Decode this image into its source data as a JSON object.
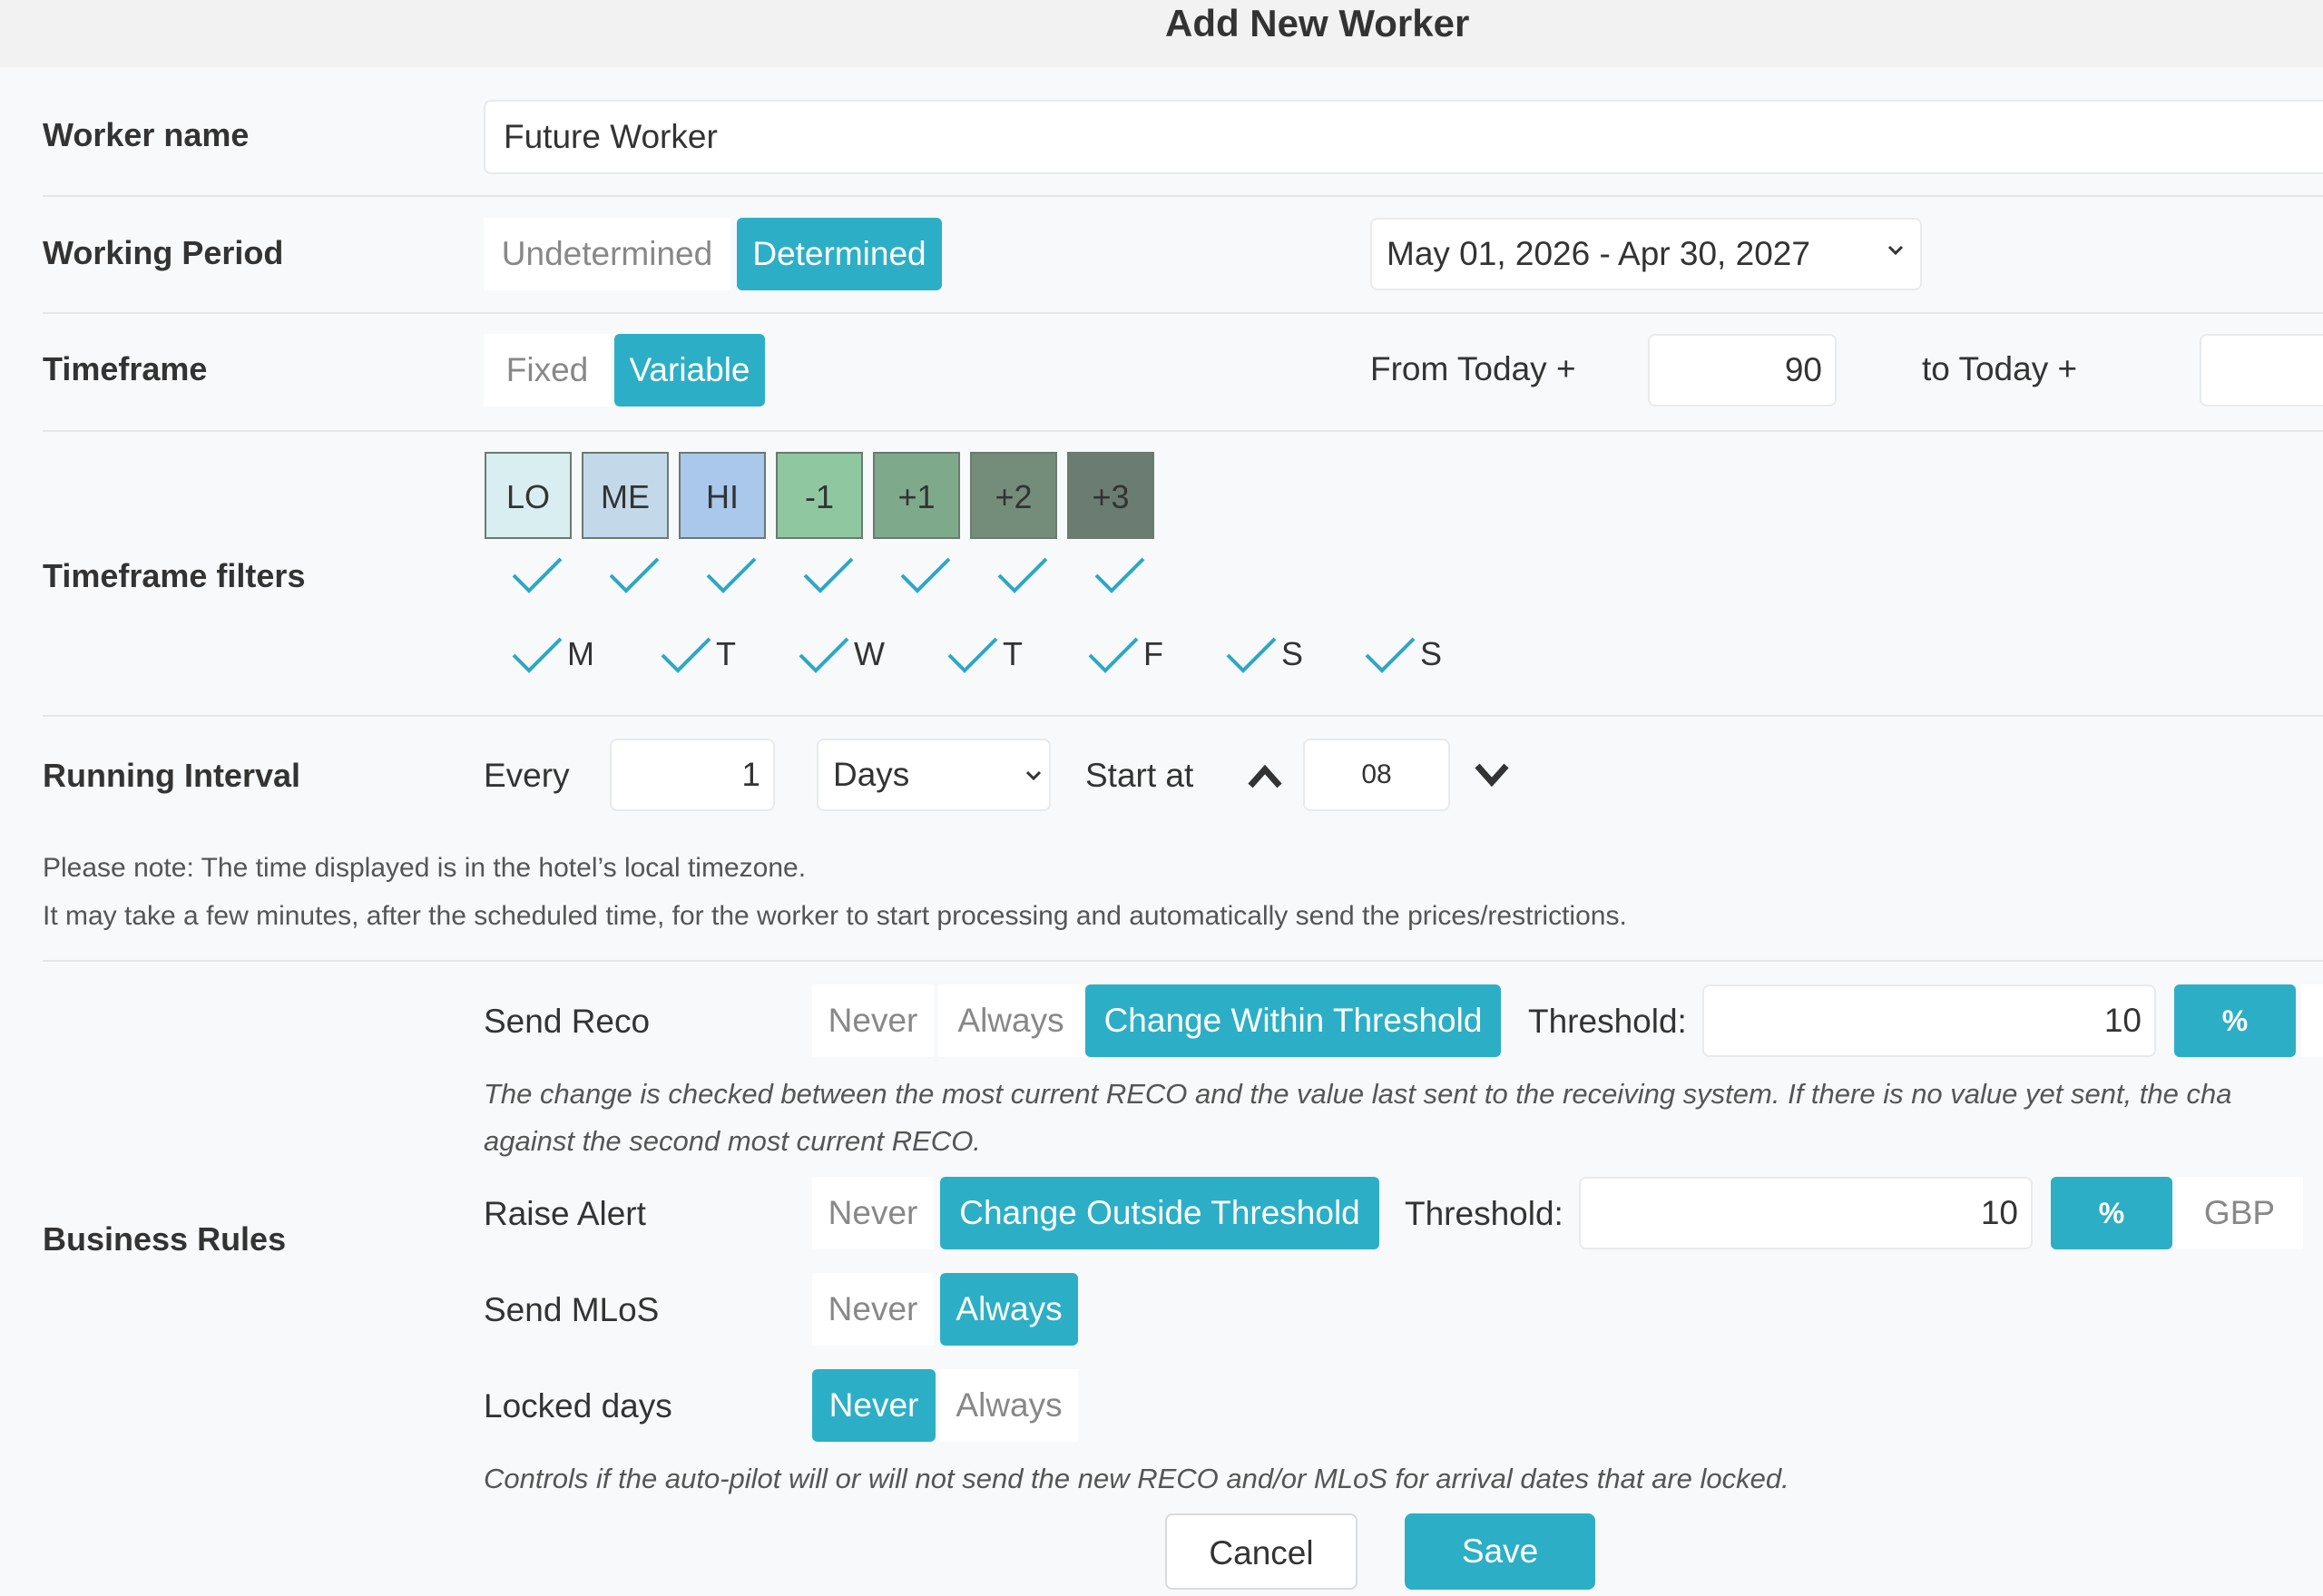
{
  "dialog": {
    "title": "Add New Worker"
  },
  "worker_name": {
    "label": "Worker name",
    "value": "Future Worker"
  },
  "working_period": {
    "label": "Working Period",
    "options": [
      "Undetermined",
      "Determined"
    ],
    "selected": "Determined",
    "date_range": "May 01, 2026 - Apr 30, 2027"
  },
  "timeframe": {
    "label": "Timeframe",
    "options": [
      "Fixed",
      "Variable"
    ],
    "selected": "Variable",
    "from_label": "From Today +",
    "from_value": "90",
    "to_label": "to Today +"
  },
  "timeframe_filters": {
    "label": "Timeframe filters",
    "chips": [
      {
        "label": "LO",
        "color": "#d8eef0",
        "checked": true
      },
      {
        "label": "ME",
        "color": "#c3d9ea",
        "checked": true
      },
      {
        "label": "HI",
        "color": "#a9c8ec",
        "checked": true
      },
      {
        "label": "-1",
        "color": "#8fc8a0",
        "checked": true
      },
      {
        "label": "+1",
        "color": "#7fa98b",
        "checked": true
      },
      {
        "label": "+2",
        "color": "#748d7a",
        "checked": true
      },
      {
        "label": "+3",
        "color": "#6b7d72",
        "checked": true
      }
    ],
    "days": [
      "M",
      "T",
      "W",
      "T",
      "F",
      "S",
      "S"
    ]
  },
  "running_interval": {
    "label": "Running Interval",
    "every_label": "Every",
    "every_value": "1",
    "unit": "Days",
    "start_label": "Start at",
    "start_value": "08"
  },
  "notes": {
    "line1": "Please note: The time displayed is in the hotel’s local timezone.",
    "line2": "It may take a few minutes, after the scheduled time, for the worker to start processing and automatically send the prices/restrictions."
  },
  "business_rules": {
    "label": "Business Rules",
    "send_reco": {
      "label": "Send Reco",
      "options": [
        "Never",
        "Always",
        "Change Within Threshold"
      ],
      "selected": "Change Within Threshold",
      "threshold_label": "Threshold:",
      "threshold_value": "10",
      "unit_selected": "%",
      "help_line1": "The change is checked between the most current RECO and the value last sent to the receiving system. If there is no value yet sent, the cha",
      "help_line2": "against the second most current RECO."
    },
    "raise_alert": {
      "label": "Raise Alert",
      "options": [
        "Never",
        "Change Outside Threshold"
      ],
      "selected": "Change Outside Threshold",
      "threshold_label": "Threshold:",
      "threshold_value": "10",
      "units": [
        "%",
        "GBP"
      ],
      "unit_selected": "%"
    },
    "send_mlos": {
      "label": "Send MLoS",
      "options": [
        "Never",
        "Always"
      ],
      "selected": "Always"
    },
    "locked_days": {
      "label": "Locked days",
      "options": [
        "Never",
        "Always"
      ],
      "selected": "Never",
      "help": "Controls if the auto-pilot will or will not send the new RECO and/or MLoS for arrival dates that are locked."
    }
  },
  "footer": {
    "cancel_label": "Cancel",
    "save_label": "Save"
  },
  "colors": {
    "accent": "#2cafc6",
    "check": "#2ea7c4"
  }
}
